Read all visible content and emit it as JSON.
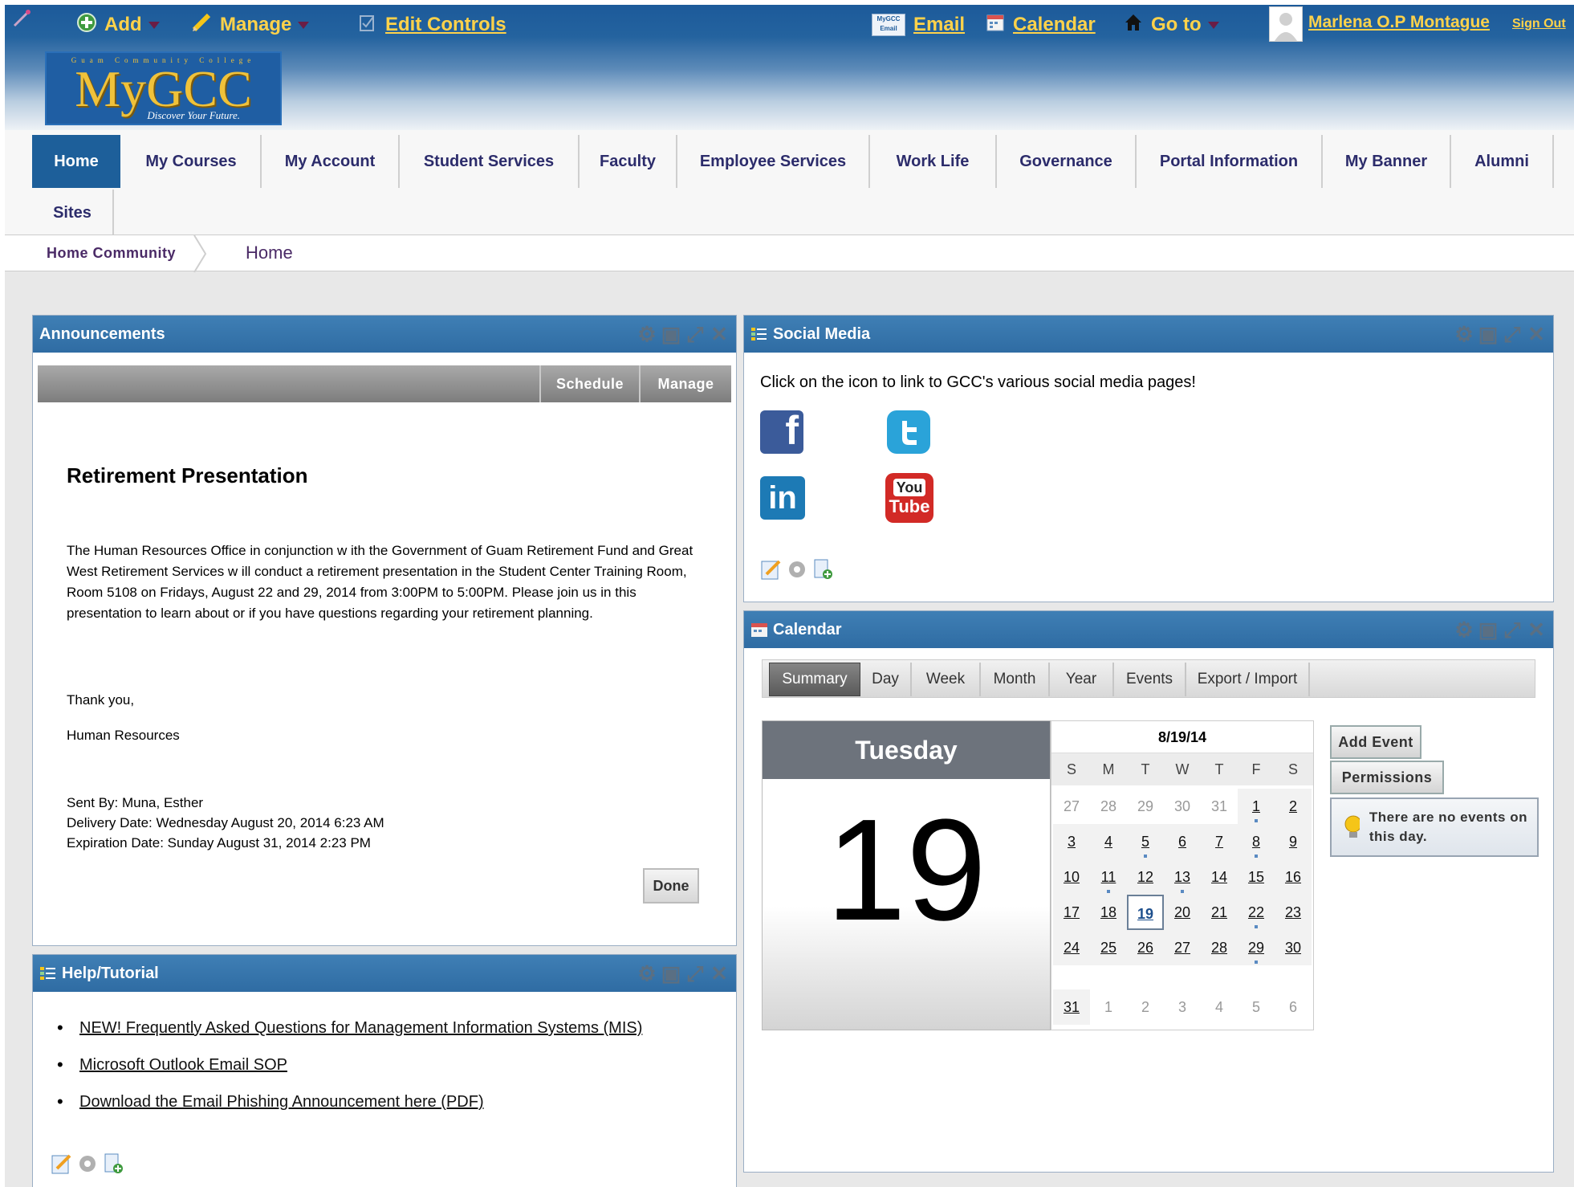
{
  "topbar": {
    "add_label": "Add",
    "manage_label": "Manage",
    "edit_controls_label": "Edit Controls",
    "email_label": "Email",
    "email_icon_text": "MyGCC Email",
    "calendar_label": "Calendar",
    "goto_label": "Go to",
    "user_name": "Marlena O.P Montague",
    "signout_label": "Sign Out"
  },
  "logo": {
    "tagline": "Guam Community College",
    "name": "MyGCC",
    "slogan": "Discover Your Future."
  },
  "nav": {
    "tabs": [
      {
        "label": "Home"
      },
      {
        "label": "My Courses"
      },
      {
        "label": "My Account"
      },
      {
        "label": "Student Services"
      },
      {
        "label": "Faculty"
      },
      {
        "label": "Employee Services"
      },
      {
        "label": "Work Life"
      },
      {
        "label": "Governance"
      },
      {
        "label": "Portal Information"
      },
      {
        "label": "My Banner"
      },
      {
        "label": "Alumni"
      },
      {
        "label": "Sites"
      }
    ],
    "active": "Home"
  },
  "breadcrumb": {
    "community": "Home Community",
    "current": "Home"
  },
  "announcements": {
    "title": "Announcements",
    "schedule_label": "Schedule",
    "manage_label": "Manage",
    "heading": "Retirement Presentation",
    "body": "The Human Resources Office in conjunction w ith the Government of Guam Retirement Fund and Great West Retirement Services w ill conduct a retirement presentation in the Student Center Training Room, Room 5108 on Fridays, August 22 and 29, 2014 from 3:00PM to 5:00PM.  Please join us in this presentation to learn about or if you have questions regarding your retirement planning.",
    "thanks": "Thank you,",
    "signature": "Human Resources",
    "sent_by": "Sent By: Muna, Esther",
    "delivery_date": "Delivery Date: Wednesday August 20, 2014 6:23 AM",
    "expiration_date": "Expiration Date: Sunday August 31, 2014 2:23 PM",
    "done_label": "Done"
  },
  "help": {
    "title": "Help/Tutorial",
    "links": [
      "NEW! Frequently Asked Questions for Management Information Systems (MIS)",
      "Microsoft Outlook Email SOP",
      "Download the Email Phishing Announcement here (PDF)"
    ]
  },
  "social": {
    "title": "Social Media",
    "intro": "Click on the icon to link to GCC's various social media pages!",
    "facebook": "f",
    "linkedin": "in",
    "youtube_top": "You",
    "youtube_bottom": "Tube"
  },
  "calendar": {
    "title": "Calendar",
    "tabs": [
      "Summary",
      "Day",
      "Week",
      "Month",
      "Year",
      "Events",
      "Export / Import"
    ],
    "active_tab": "Summary",
    "weekday": "Tuesday",
    "day_number": "19",
    "mini_title": "8/19/14",
    "dow": [
      "S",
      "M",
      "T",
      "W",
      "T",
      "F",
      "S"
    ],
    "weeks": [
      [
        "27",
        "28",
        "29",
        "30",
        "31",
        "1",
        "2"
      ],
      [
        "3",
        "4",
        "5",
        "6",
        "7",
        "8",
        "9"
      ],
      [
        "10",
        "11",
        "12",
        "13",
        "14",
        "15",
        "16"
      ],
      [
        "17",
        "18",
        "19",
        "20",
        "21",
        "22",
        "23"
      ],
      [
        "24",
        "25",
        "26",
        "27",
        "28",
        "29",
        "30"
      ],
      [
        "31",
        "1",
        "2",
        "3",
        "4",
        "5",
        "6"
      ]
    ],
    "add_event_label": "Add Event",
    "permissions_label": "Permissions",
    "no_events_text": "There are no events on this day.",
    "colors": {
      "header": "#2f6ca3",
      "today_border": "#6a7f97"
    }
  }
}
